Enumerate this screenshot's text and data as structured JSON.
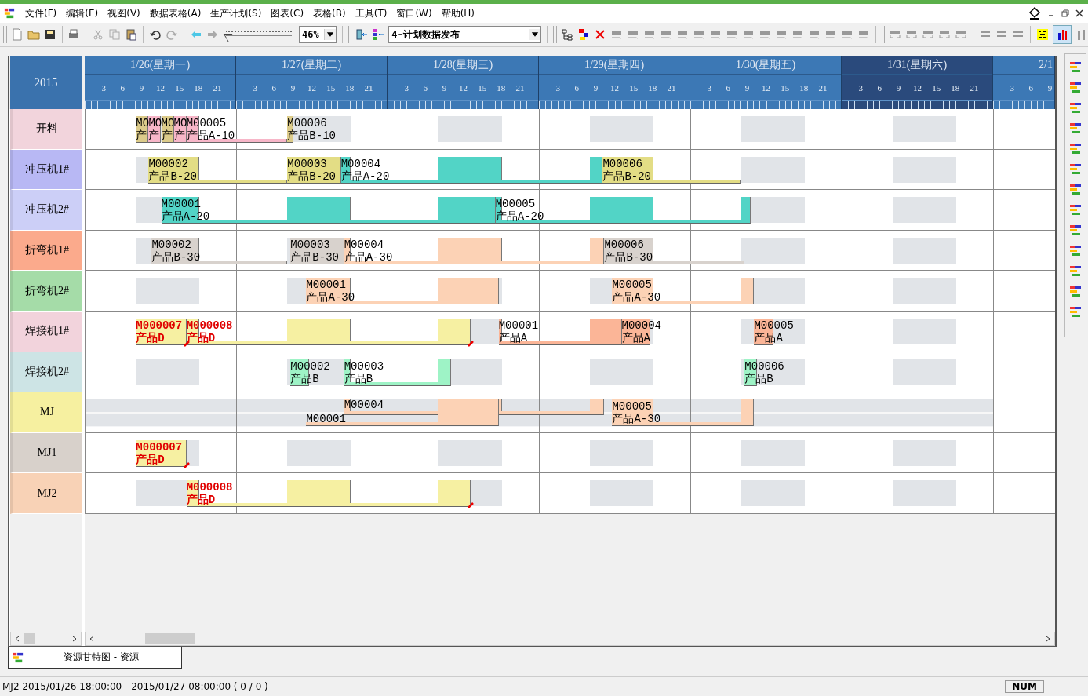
{
  "menu": [
    "文件(F)",
    "编辑(E)",
    "视图(V)",
    "数据表格(A)",
    "生产计划(S)",
    "图表(C)",
    "表格(B)",
    "工具(T)",
    "窗口(W)",
    "帮助(H)"
  ],
  "toolbar": {
    "zoom_slider": {
      "level": 0.05
    },
    "zoom": "46%",
    "plan": "4-计划数据发布",
    "chart_button": {
      "selected": true
    }
  },
  "gantt": {
    "year": "2015",
    "days": [
      {
        "title": "1/26(星期一)",
        "weekend": false,
        "working": true,
        "hours": [
          "3",
          "6",
          "9",
          "12",
          "15",
          "18",
          "21"
        ]
      },
      {
        "title": "1/27(星期二)",
        "weekend": false,
        "working": true,
        "hours": [
          "3",
          "6",
          "9",
          "12",
          "15",
          "18",
          "21"
        ]
      },
      {
        "title": "1/28(星期三)",
        "weekend": false,
        "working": true,
        "hours": [
          "3",
          "6",
          "9",
          "12",
          "15",
          "18",
          "21"
        ]
      },
      {
        "title": "1/29(星期四)",
        "weekend": false,
        "working": true,
        "hours": [
          "3",
          "6",
          "9",
          "12",
          "15",
          "18",
          "21"
        ]
      },
      {
        "title": "1/30(星期五)",
        "weekend": false,
        "working": true,
        "hours": [
          "3",
          "6",
          "9",
          "12",
          "15",
          "18",
          "21"
        ]
      },
      {
        "title": "1/31(星期六)",
        "weekend": true,
        "working": true,
        "hours": [
          "3",
          "6",
          "9",
          "12",
          "15",
          "18",
          "21"
        ]
      },
      {
        "title": "2/1",
        "weekend": false,
        "working": false,
        "hours": [
          "3",
          "6",
          "9"
        ]
      }
    ],
    "rows": [
      {
        "name": "开料",
        "color": "#f2d4dc",
        "kind": "normal",
        "tasks": [
          {
            "lines": [
              "MO",
              "产"
            ],
            "color": "#dccb8a",
            "late": false
          },
          {
            "lines": [
              "MO",
              "产"
            ],
            "color": "#f7b6c8",
            "late": false
          },
          {
            "lines": [
              "MO",
              "产"
            ],
            "color": "#dccb8a",
            "late": false
          },
          {
            "lines": [
              "MO",
              "产"
            ],
            "color": "#f7b6c8",
            "late": false
          },
          {
            "lines": [
              "M00005",
              "产品A-10"
            ],
            "color": "#f7b6c8",
            "late": false
          },
          {
            "lines": [
              "M00006",
              "产品B-10"
            ],
            "color": "#dccb8a",
            "late": false
          }
        ]
      },
      {
        "name": "冲压机1#",
        "color": "#b8b8f4",
        "kind": "normal",
        "tasks": [
          {
            "lines": [
              "M00002",
              "产品B-20"
            ],
            "color": "#e3dd85",
            "late": false
          },
          {
            "lines": [
              "M00003",
              "产品B-20"
            ],
            "color": "#e3dd85",
            "late": false
          },
          {
            "lines": [
              "M00004",
              "产品A-20"
            ],
            "color": "#52d4c6",
            "late": false
          },
          {
            "lines": [
              "M00006",
              "产品B-20"
            ],
            "color": "#e3dd85",
            "late": false
          }
        ]
      },
      {
        "name": "冲压机2#",
        "color": "#cccff7",
        "kind": "normal",
        "tasks": [
          {
            "lines": [
              "M00001",
              "产品A-20"
            ],
            "color": "#52d4c6",
            "late": false
          },
          {
            "lines": [
              "M00005",
              "产品A-20"
            ],
            "color": "#52d4c6",
            "late": false
          }
        ]
      },
      {
        "name": "折弯机1#",
        "color": "#fbaa8c",
        "kind": "normal",
        "tasks": [
          {
            "lines": [
              "M00002",
              "产品B-30"
            ],
            "color": "#d8d2cd",
            "late": false
          },
          {
            "lines": [
              "M00003",
              "产品B-30"
            ],
            "color": "#d8d2cd",
            "late": false
          },
          {
            "lines": [
              "M00004",
              "产品A-30"
            ],
            "color": "#fcd2b5",
            "late": false
          },
          {
            "lines": [
              "M00006",
              "产品B-30"
            ],
            "color": "#d8d2cd",
            "late": false
          }
        ]
      },
      {
        "name": "折弯机2#",
        "color": "#a5dca8",
        "kind": "normal",
        "tasks": [
          {
            "lines": [
              "M00001",
              "产品A-30"
            ],
            "color": "#fcd2b5",
            "late": false
          },
          {
            "lines": [
              "M00005",
              "产品A-30"
            ],
            "color": "#fcd2b5",
            "late": false
          }
        ]
      },
      {
        "name": "焊接机1#",
        "color": "#f2d3dc",
        "kind": "normal",
        "tasks": [
          {
            "lines": [
              "M000007",
              "产品D"
            ],
            "color": "#f6f0a2",
            "late": true
          },
          {
            "lines": [
              "M000008",
              "产品D"
            ],
            "color": "#f6f0a2",
            "late": true
          },
          {
            "lines": [
              "M00001",
              "产品A"
            ],
            "color": "#fbb597",
            "late": false
          },
          {
            "lines": [
              "M00004",
              "产品A"
            ],
            "color": "#fbb597",
            "late": false
          },
          {
            "lines": [
              "M00005",
              "产品A"
            ],
            "color": "#fbb597",
            "late": false
          }
        ]
      },
      {
        "name": "焊接机2#",
        "color": "#cde4e5",
        "kind": "normal",
        "tasks": [
          {
            "lines": [
              "M00002",
              "产品B"
            ],
            "color": "#9ef3c6",
            "late": false
          },
          {
            "lines": [
              "M00003",
              "产品B"
            ],
            "color": "#9ef3c6",
            "late": false
          },
          {
            "lines": [
              "M00006",
              "产品B"
            ],
            "color": "#9ef3c6",
            "late": false
          }
        ]
      },
      {
        "name": "MJ",
        "color": "#f6f0a0",
        "kind": "shared",
        "tasks": [
          {
            "lines": [
              "M00004"
            ],
            "color": "#fcd2b5",
            "late": false
          },
          {
            "lines": [
              "M00001"
            ],
            "color": "#fcd2b5",
            "late": false
          },
          {
            "lines": [
              "M00005",
              "产品A-30"
            ],
            "color": "#fcd2b5",
            "late": false
          }
        ]
      },
      {
        "name": "MJ1",
        "color": "#d8d1cb",
        "kind": "normal",
        "tasks": [
          {
            "lines": [
              "M000007",
              "产品D"
            ],
            "color": "#f6f0a2",
            "late": true
          }
        ]
      },
      {
        "name": "MJ2",
        "color": "#f8d2b6",
        "kind": "normal",
        "tasks": [
          {
            "lines": [
              "M000008",
              "产品D"
            ],
            "color": "#f6f0a2",
            "late": true
          }
        ]
      }
    ]
  },
  "tab": {
    "label": "资源甘特图 - 资源",
    "selected": true
  },
  "status_bar": {
    "text": "MJ2 2015/01/26 18:00:00 - 2015/01/27 08:00:00 ( 0 / 0 )",
    "indicator": "NUM"
  }
}
